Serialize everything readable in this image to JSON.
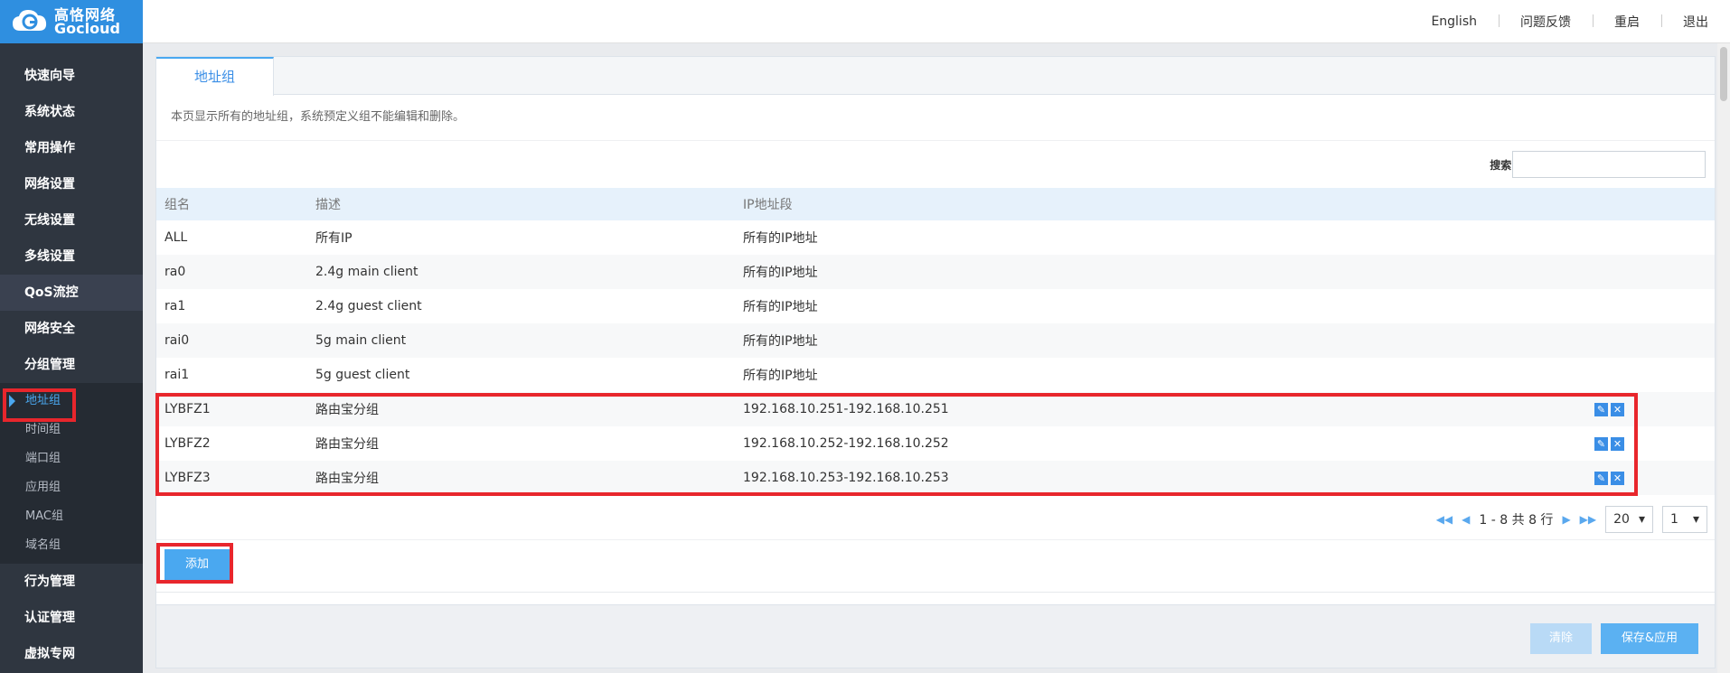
{
  "logo": {
    "cn": "高恪网络",
    "en": "Gocloud"
  },
  "header": {
    "links": [
      "English",
      "问题反馈",
      "重启",
      "退出"
    ]
  },
  "sidebar": {
    "items_top": [
      "快速向导",
      "系统状态",
      "常用操作",
      "网络设置",
      "无线设置",
      "多线设置",
      "QoS流控",
      "网络安全",
      "分组管理"
    ],
    "sub_items": [
      "地址组",
      "时间组",
      "端口组",
      "应用组",
      "MAC组",
      "域名组"
    ],
    "items_bottom": [
      "行为管理",
      "认证管理",
      "虚拟专网"
    ]
  },
  "tab": {
    "label": "地址组"
  },
  "notice": "本页显示所有的地址组，系统预定义组不能编辑和删除。",
  "search": {
    "label": "搜索:",
    "placeholder": ""
  },
  "table": {
    "headers": [
      "组名",
      "描述",
      "IP地址段"
    ],
    "rows": [
      {
        "name": "ALL",
        "desc": "所有IP",
        "ip": "所有的IP地址",
        "editable": false
      },
      {
        "name": "ra0",
        "desc": "2.4g main client",
        "ip": "所有的IP地址",
        "editable": false
      },
      {
        "name": "ra1",
        "desc": "2.4g guest client",
        "ip": "所有的IP地址",
        "editable": false
      },
      {
        "name": "rai0",
        "desc": "5g main client",
        "ip": "所有的IP地址",
        "editable": false
      },
      {
        "name": "rai1",
        "desc": "5g guest client",
        "ip": "所有的IP地址",
        "editable": false
      },
      {
        "name": "LYBFZ1",
        "desc": "路由宝分组",
        "ip": "192.168.10.251-192.168.10.251",
        "editable": true
      },
      {
        "name": "LYBFZ2",
        "desc": "路由宝分组",
        "ip": "192.168.10.252-192.168.10.252",
        "editable": true
      },
      {
        "name": "LYBFZ3",
        "desc": "路由宝分组",
        "ip": "192.168.10.253-192.168.10.253",
        "editable": true
      }
    ]
  },
  "pager": {
    "summary": "1 - 8 共 8 行",
    "page_size": "20",
    "page": "1"
  },
  "buttons": {
    "add": "添加",
    "clear": "清除",
    "save": "保存&应用"
  },
  "colors": {
    "brand": "#2f8fe0",
    "highlight": "#e8262c",
    "accent": "#4aa8f0"
  }
}
